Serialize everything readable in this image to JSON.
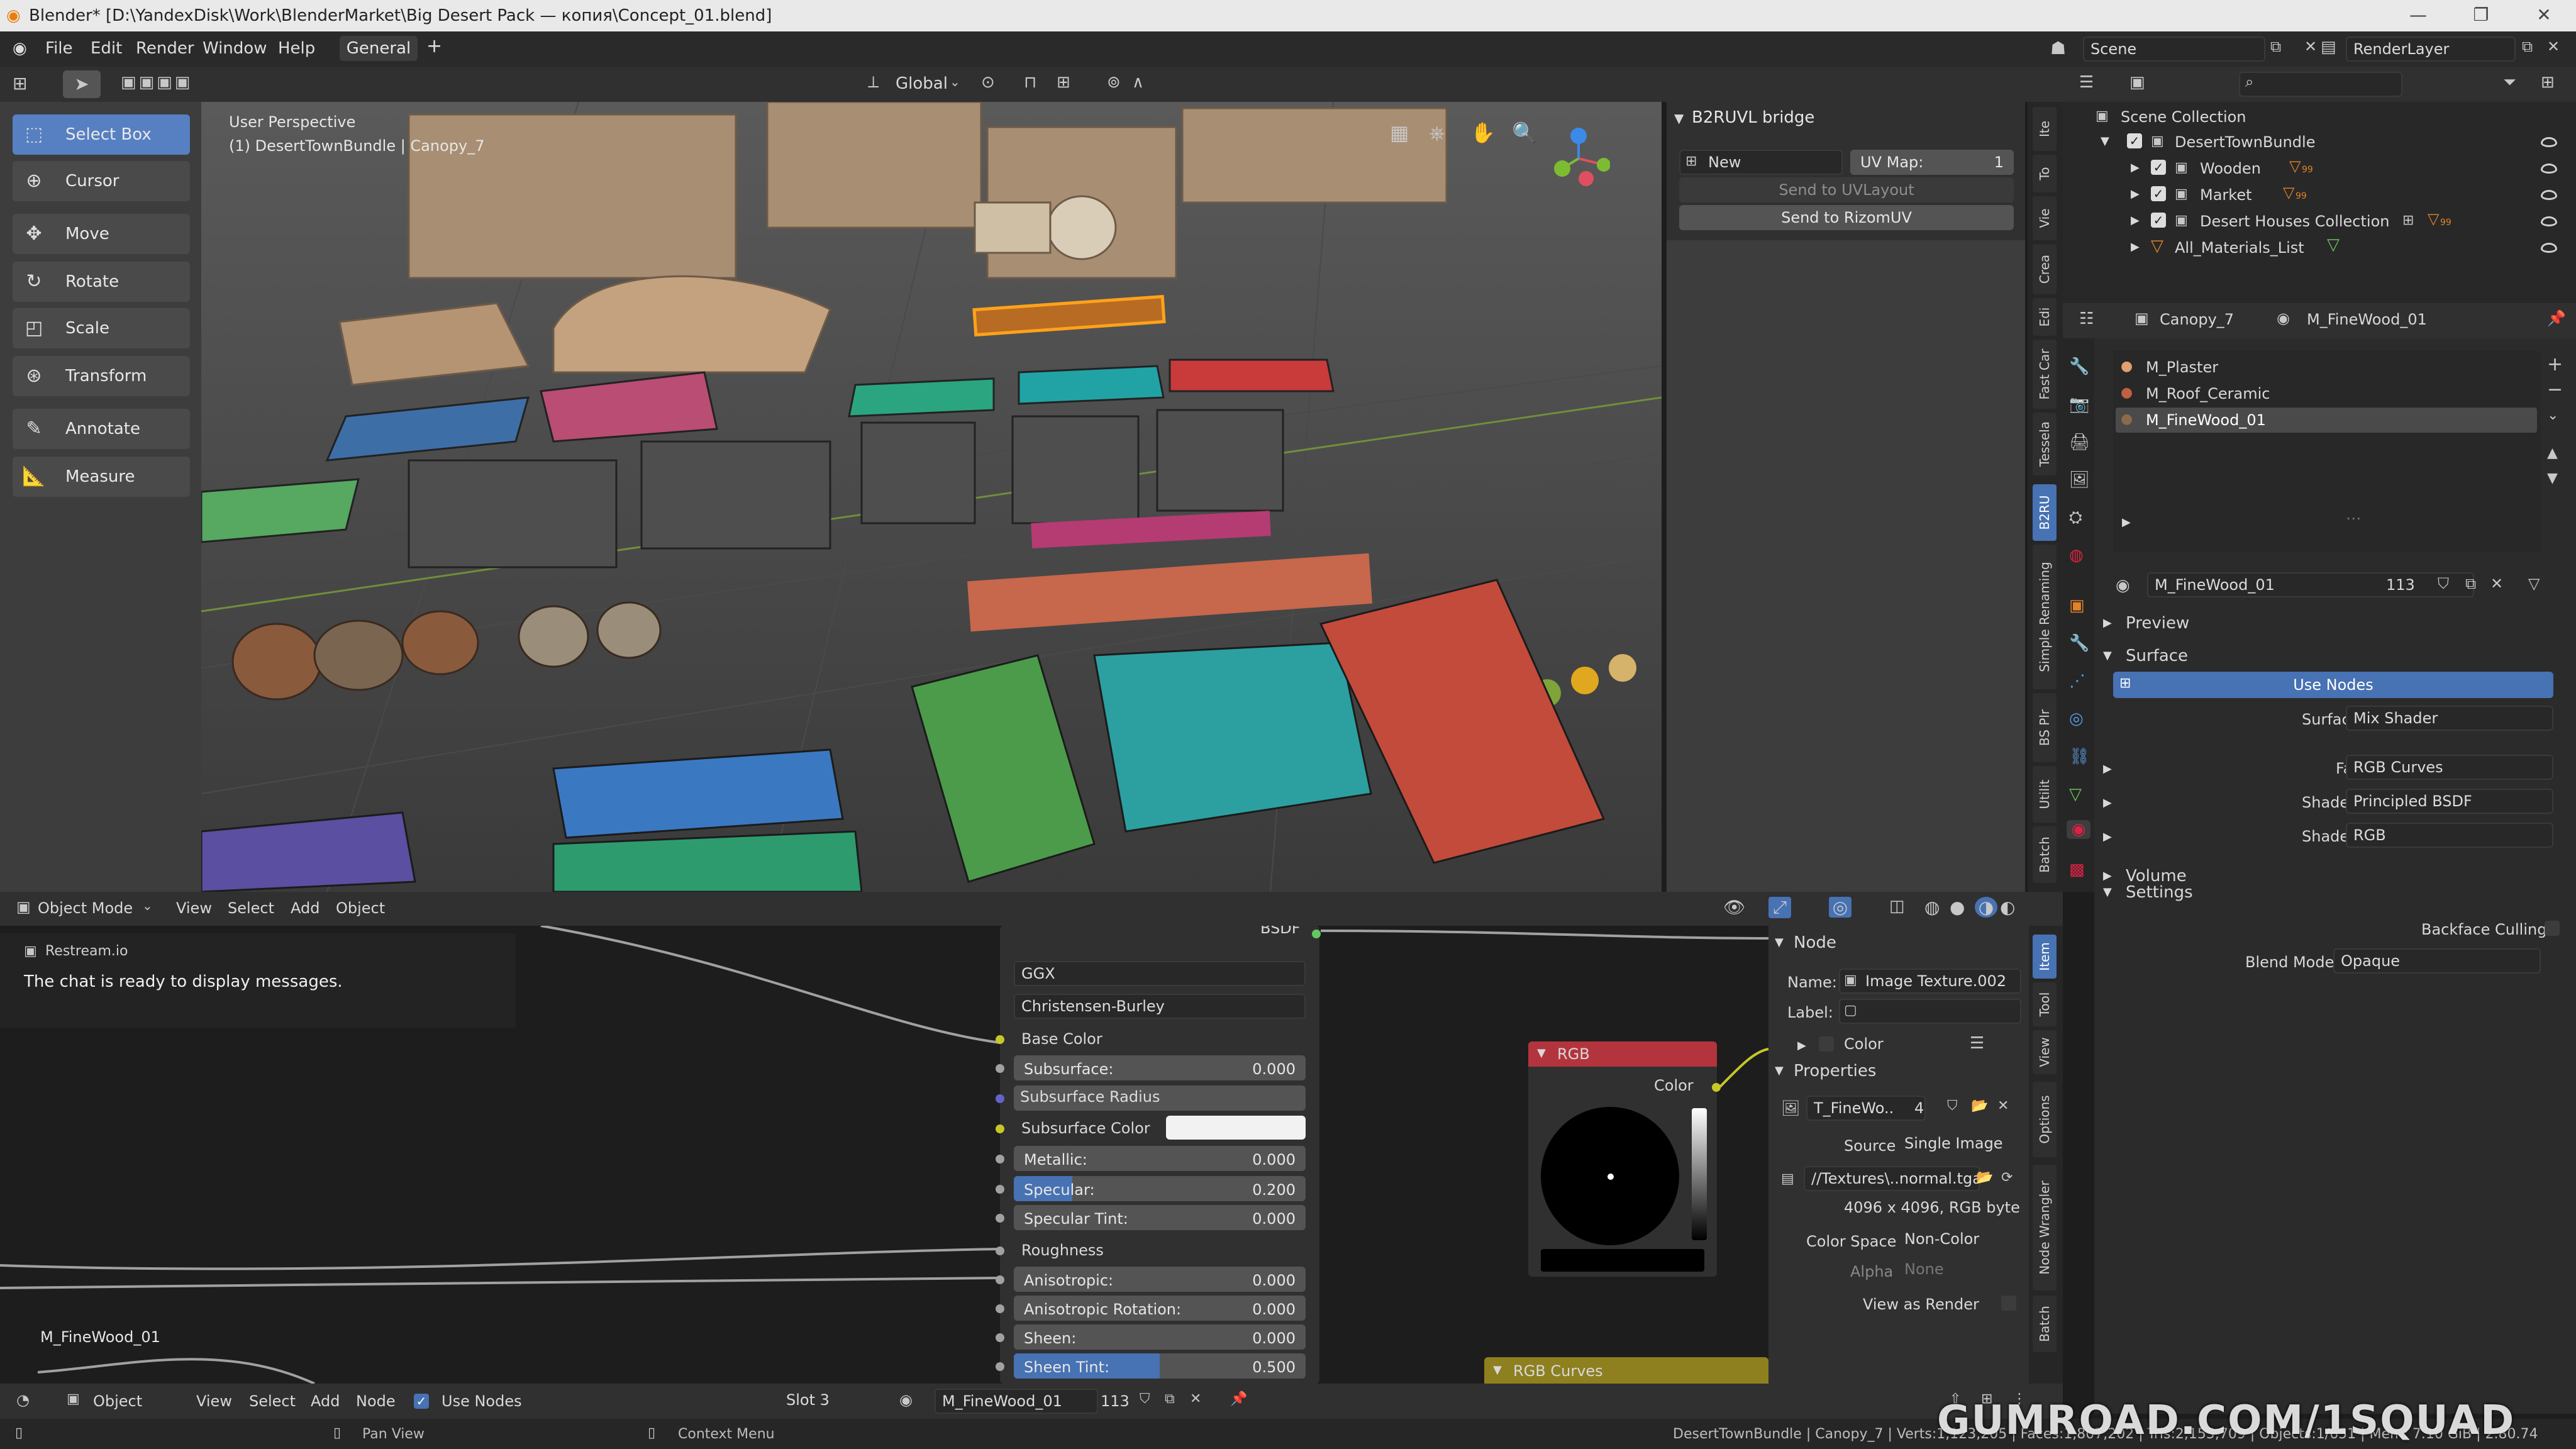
{
  "window": {
    "title": "Blender* [D:\\YandexDisk\\Work\\BlenderMarket\\Big Desert Pack — копия\\Concept_01.blend]"
  },
  "menu": {
    "items": [
      "File",
      "Edit",
      "Render",
      "Window",
      "Help"
    ],
    "workspace_tab": "General",
    "scene": "Scene",
    "render_layer": "RenderLayer"
  },
  "viewport_header": {
    "orientation": "Global",
    "mode": "Object Mode",
    "menus": [
      "View",
      "Select",
      "Add",
      "Object"
    ]
  },
  "tools": [
    "Select Box",
    "Cursor",
    "Move",
    "Rotate",
    "Scale",
    "Transform",
    "Annotate",
    "Measure"
  ],
  "viewport": {
    "perspective": "User Perspective",
    "object_info": "(1) DesertTownBundle | Canopy_7"
  },
  "b2ruvl": {
    "title": "B2RUVL bridge",
    "new_label": "New",
    "uvmap_label": "UV Map:",
    "uvmap_value": "1",
    "send_uvlayout": "Send to UVLayout",
    "send_rizom": "Send to RizomUV"
  },
  "viewport_tabs": [
    "Ite",
    "To",
    "Vie",
    "Crea",
    "Edi",
    "Fast Car",
    "Tessela",
    "B2RU",
    "Simple Renaming",
    "BS Plr",
    "Utilit",
    "Batch"
  ],
  "outliner": {
    "root": "Scene Collection",
    "items": [
      {
        "label": "DesertTownBundle",
        "level": 0
      },
      {
        "label": "Wooden",
        "level": 1,
        "badge": "99"
      },
      {
        "label": "Market",
        "level": 1,
        "badge": "99"
      },
      {
        "label": "Desert Houses Collection",
        "level": 1,
        "badge": "99"
      },
      {
        "label": "All_Materials_List",
        "level": 1
      }
    ]
  },
  "properties": {
    "object": "Canopy_7",
    "material": "M_FineWood_01",
    "slots": [
      "M_Plaster",
      "M_Roof_Ceramic",
      "M_FineWood_01"
    ],
    "material_field": "M_FineWood_01",
    "users": "113",
    "sections": {
      "preview": "Preview",
      "surface": "Surface",
      "volume": "Volume",
      "settings": "Settings"
    },
    "use_nodes": "Use Nodes",
    "surface_label": "Surface",
    "surface_value": "Mix Shader",
    "fac_label": "Fac",
    "fac_value": "RGB Curves",
    "shader1_label": "Shader",
    "shader1_value": "Principled BSDF",
    "shader2_label": "Shader",
    "shader2_value": "RGB",
    "backface": "Backface Culling",
    "blend_mode_label": "Blend Mode",
    "blend_mode_value": "Opaque"
  },
  "restream": {
    "title": "Restream.io",
    "message": "The chat is ready to display messages."
  },
  "node_editor": {
    "material_label": "M_FineWood_01",
    "bsdf_title": "BSDF",
    "distribution": "GGX",
    "subsurface_method": "Christensen-Burley",
    "base_color": "Base Color",
    "subsurface_label": "Subsurface:",
    "subsurface_value": "0.000",
    "subsurface_radius": "Subsurface Radius",
    "subsurface_color": "Subsurface Color",
    "metallic_label": "Metallic:",
    "metallic_value": "0.000",
    "specular_label": "Specular:",
    "specular_value": "0.200",
    "specular_fill": 0.2,
    "specular_tint_label": "Specular Tint:",
    "specular_tint_value": "0.000",
    "roughness": "Roughness",
    "anisotropic_label": "Anisotropic:",
    "anisotropic_value": "0.000",
    "anisotropic_rot_label": "Anisotropic Rotation:",
    "anisotropic_rot_value": "0.000",
    "sheen_label": "Sheen:",
    "sheen_value": "0.000",
    "sheen_tint_label": "Sheen Tint:",
    "sheen_tint_value": "0.500",
    "sheen_tint_fill": 0.5,
    "rgb_title": "RGB",
    "rgb_output": "Color",
    "rgb_curves_title": "RGB Curves",
    "header": {
      "editor": "Object",
      "menus": [
        "View",
        "Select",
        "Add",
        "Node"
      ],
      "use_nodes": "Use Nodes",
      "slot": "Slot 3",
      "material": "M_FineWood_01",
      "users": "113"
    }
  },
  "node_panel": {
    "title": "Node",
    "name_label": "Name:",
    "name_value": "Image Texture.002",
    "label_label": "Label:",
    "color_label": "Color",
    "properties_title": "Properties",
    "image_name": "T_FineWo..",
    "image_users": "4",
    "source_label": "Source",
    "source_value": "Single Image",
    "path_value": "//Textures\\..normal.tga",
    "image_info": "4096 x 4096,  RGB byte",
    "colorspace_label": "Color Space",
    "colorspace_value": "Non-Color",
    "alpha_label": "Alpha",
    "alpha_value": "None",
    "view_as_render": "View as Render"
  },
  "node_side_tabs": [
    "Item",
    "Tool",
    "View",
    "Options",
    "Node Wrangler",
    "Batch"
  ],
  "statusbar": {
    "pan": "Pan View",
    "context": "Context Menu",
    "stats": "DesertTownBundle | Canopy_7 | Verts:1,123,205 | Faces:1,807,202 | Tris:2,155,709 | Objects:1/651 | Mem: 7.10 GiB | 2.80.74"
  },
  "watermark": "GUMROAD.COM/1SQUAD",
  "colors": {
    "accent": "#4772b3",
    "rgb_header": "#b4343d",
    "curves_header": "#8e7f1f",
    "socket_yellow": "#c7c729",
    "socket_gray": "#a1a1a1",
    "socket_purple": "#6363c7",
    "socket_green": "#63c763"
  }
}
